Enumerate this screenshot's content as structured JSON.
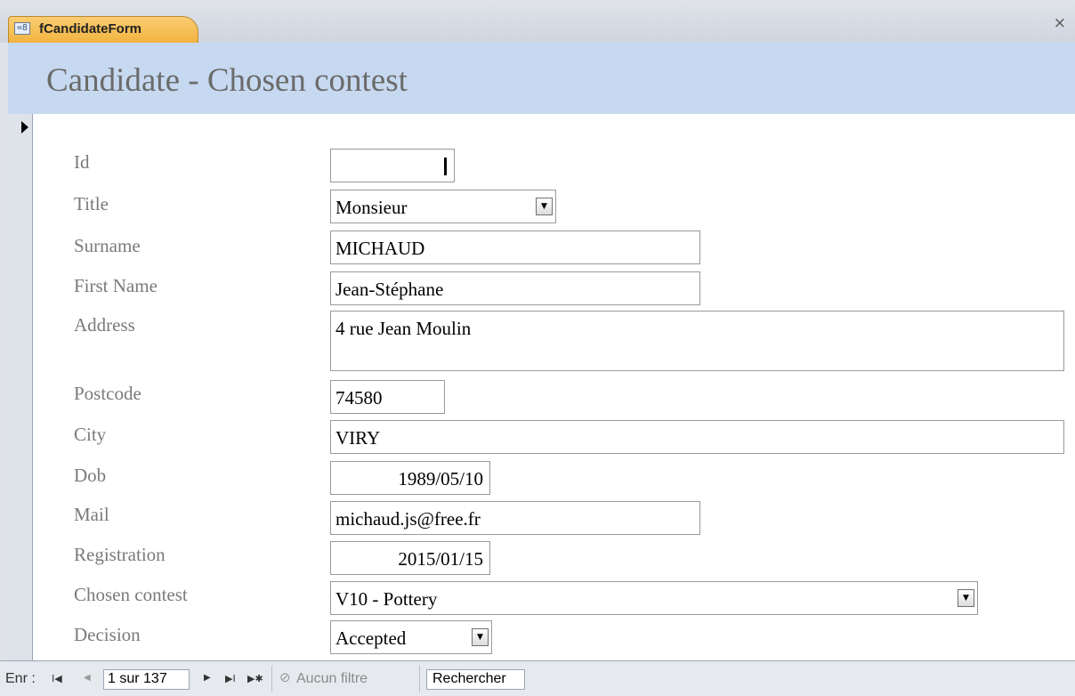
{
  "tab": {
    "title": "fCandidateForm",
    "icon": "form-icon",
    "icon_glyph": "=8"
  },
  "close_glyph": "×",
  "form": {
    "title": "Candidate - Chosen contest"
  },
  "fields": {
    "id": {
      "label": "Id",
      "value": ""
    },
    "title": {
      "label": "Title",
      "value": "Monsieur"
    },
    "surname": {
      "label": "Surname",
      "value": "MICHAUD"
    },
    "first_name": {
      "label": "First Name",
      "value": "Jean-Stéphane"
    },
    "address": {
      "label": "Address",
      "value": "4 rue Jean Moulin"
    },
    "postcode": {
      "label": "Postcode",
      "value": "74580"
    },
    "city": {
      "label": "City",
      "value": "VIRY"
    },
    "dob": {
      "label": "Dob",
      "value": "1989/05/10"
    },
    "mail": {
      "label": "Mail",
      "value": "michaud.js@free.fr"
    },
    "registration": {
      "label": "Registration",
      "value": "2015/01/15"
    },
    "chosen_contest": {
      "label": "Chosen contest",
      "value": "V10 - Pottery"
    },
    "decision": {
      "label": "Decision",
      "value": "Accepted"
    }
  },
  "dropdown_glyph": "▼",
  "navigation": {
    "record_label": "Enr :",
    "first_glyph": "I◀",
    "prev_glyph": "◀",
    "record_position": "1 sur 137",
    "next_glyph": "▶",
    "last_glyph": "▶I",
    "new_glyph": "▶✱",
    "filter_glyph": "⊘",
    "filter_status": "Aucun filtre",
    "search_label": "Rechercher"
  }
}
